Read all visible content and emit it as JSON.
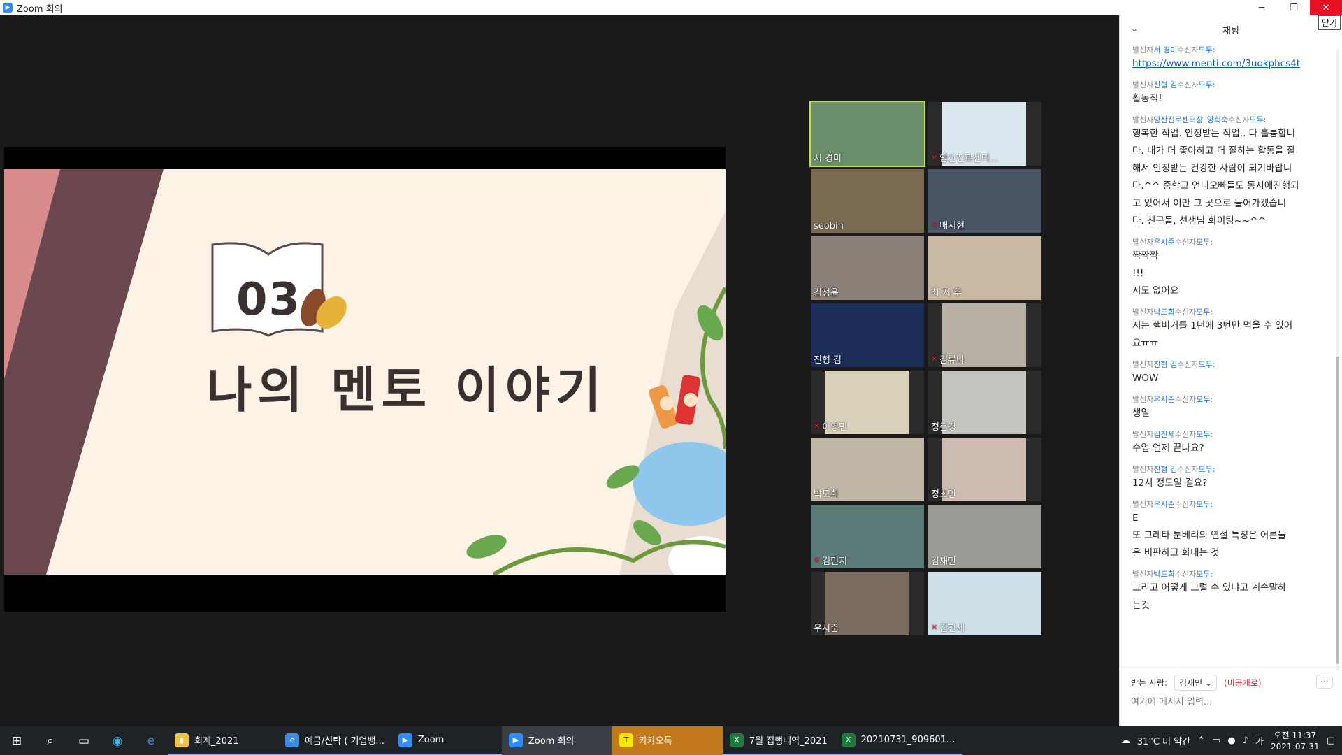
{
  "window": {
    "title": "Zoom 회의",
    "close_tooltip": "닫기"
  },
  "slide": {
    "number": "03",
    "title": "나의 멘토 이야기"
  },
  "participants": [
    {
      "name": "서 경미",
      "muted": false,
      "active": true
    },
    {
      "name": "양산진로센터...",
      "muted": true
    },
    {
      "name": "seobin",
      "muted": false
    },
    {
      "name": "배서현",
      "muted": true
    },
    {
      "name": "김정윤",
      "muted": false
    },
    {
      "name": "최 지 우",
      "muted": false
    },
    {
      "name": "진형 김",
      "muted": false
    },
    {
      "name": "김류나",
      "muted": true
    },
    {
      "name": "이영민",
      "muted": true
    },
    {
      "name": "정은경",
      "muted": false
    },
    {
      "name": "박도희",
      "muted": false
    },
    {
      "name": "정초인",
      "muted": false
    },
    {
      "name": "김민지",
      "muted": true
    },
    {
      "name": "김재민",
      "muted": false
    },
    {
      "name": "우시준",
      "muted": false
    },
    {
      "name": "김진세",
      "muted": true
    }
  ],
  "chat": {
    "title": "채팅",
    "messages": [
      {
        "prefix": "발신자",
        "sender": "서 경미",
        "mid": "수신자",
        "to": "모두:",
        "lines": [
          "https://www.menti.com/3uokphcs4t"
        ],
        "link": true
      },
      {
        "prefix": "발신자",
        "sender": "진형 김",
        "mid": "수신자",
        "to": "모두:",
        "lines": [
          "활동적!"
        ]
      },
      {
        "prefix": "발신자",
        "sender": "양산진로센터장_양희숙",
        "mid": "수신자",
        "to": "모두:",
        "lines": [
          "행복한 직업. 인정받는 직업.. 다 훌륭합니",
          "다. 내가 더 좋아하고 더 잘하는 활동을 잘",
          "해서 인정받는 건강한 사람이 되기바랍니",
          "다.^^ 중학교 언니오빠들도 동시에진행되",
          "고 있어서 이만 그 곳으로 들어가겠습니",
          "다. 친구들, 선생님 화이팅~~^^"
        ]
      },
      {
        "prefix": "발신자",
        "sender": "우시준",
        "mid": "수신자",
        "to": "모두:",
        "lines": [
          "짝짝짝",
          "!!!",
          "저도 없어요"
        ]
      },
      {
        "prefix": "발신자",
        "sender": "박도희",
        "mid": "수신자",
        "to": "모두:",
        "lines": [
          "저는 햄버거를 1년에 3번만 먹을 수 있어",
          "요ㅠㅠ"
        ]
      },
      {
        "prefix": "발신자",
        "sender": "진형 김",
        "mid": "수신자",
        "to": "모두:",
        "lines": [
          "WOW"
        ]
      },
      {
        "prefix": "발신자",
        "sender": "우시준",
        "mid": "수신자",
        "to": "모두:",
        "lines": [
          "생일"
        ]
      },
      {
        "prefix": "발신자",
        "sender": "김진세",
        "mid": "수신자",
        "to": "모두:",
        "lines": [
          "수업 언제 끝나요?"
        ]
      },
      {
        "prefix": "발신자",
        "sender": "진형 김",
        "mid": "수신자",
        "to": "모두:",
        "lines": [
          "12시 정도일 걸요?"
        ]
      },
      {
        "prefix": "발신자",
        "sender": "우시준",
        "mid": "수신자",
        "to": "모두:",
        "lines": [
          "E",
          "또 그레타 툰베리의 연설 특징은 어른들",
          "은 비판하고 화내는 것"
        ]
      },
      {
        "prefix": "발신자",
        "sender": "박도희",
        "mid": "수신자",
        "to": "모두:",
        "lines": [
          "그리고 어떻게 그럴 수 있냐고 계속말하",
          "는것"
        ]
      }
    ],
    "to_label": "받는 사람:",
    "to_value": "김재민",
    "private_label": "(비공개로)",
    "more": "···",
    "input_placeholder": "여기에 메시지 입력..."
  },
  "taskbar": {
    "apps": [
      {
        "label": "회계_2021",
        "state": "open"
      },
      {
        "label": "예금/신탁 ( 기업뱅...",
        "state": "open"
      },
      {
        "label": "Zoom",
        "state": "open"
      },
      {
        "label": "Zoom 회의",
        "state": "active"
      },
      {
        "label": "카카오톡",
        "state": "alert"
      },
      {
        "label": "7월 집행내역_2021",
        "state": "open"
      },
      {
        "label": "20210731_909601...",
        "state": "open"
      }
    ],
    "weather": "31°C 비 약간",
    "ime": "가",
    "time": "오전 11:37",
    "date": "2021-07-31"
  },
  "colors": {
    "accent": "#2d8cff",
    "active_speaker": "#c7e34a",
    "chat_sender": "#1a73e8"
  }
}
